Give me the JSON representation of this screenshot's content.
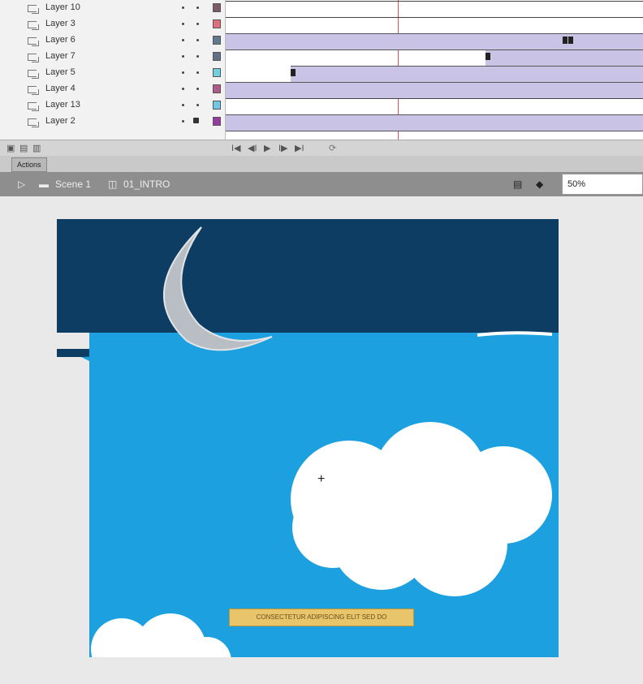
{
  "timeline": {
    "layers": [
      {
        "name": "Layer 10",
        "color": "#7d5a6a",
        "locked": false
      },
      {
        "name": "Layer 3",
        "color": "#e06c7c",
        "locked": false
      },
      {
        "name": "Layer 6",
        "color": "#607890",
        "locked": false
      },
      {
        "name": "Layer 7",
        "color": "#5f7088",
        "locked": false
      },
      {
        "name": "Layer 5",
        "color": "#6ed0e0",
        "locked": false
      },
      {
        "name": "Layer 4",
        "color": "#b05a8a",
        "locked": false
      },
      {
        "name": "Layer 13",
        "color": "#6ec8e6",
        "locked": false
      },
      {
        "name": "Layer 2",
        "color": "#9a3aa0",
        "locked": true
      }
    ],
    "controls": [
      "I◀",
      "◀I",
      "▶",
      "I▶",
      "▶I"
    ]
  },
  "panel_tab": {
    "label": "Actions"
  },
  "breadcrumb": {
    "scene": "Scene 1",
    "symbol": "01_INTRO"
  },
  "zoom": {
    "value": "50%"
  },
  "stage_text": "CONSECTETUR ADIPISCING ELIT SED DO"
}
